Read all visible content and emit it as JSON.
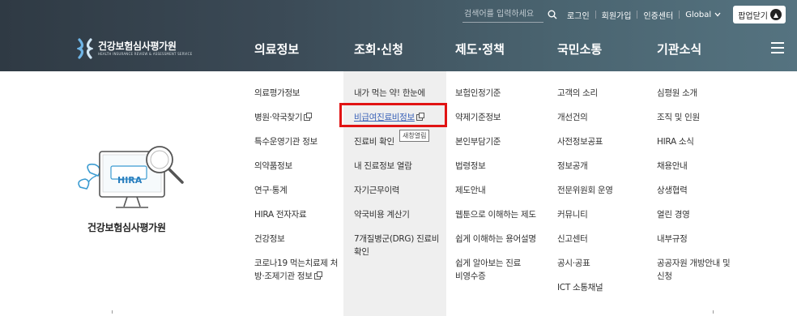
{
  "header": {
    "search_placeholder": "검색어를 입력하세요",
    "util_links": [
      "로그인",
      "회원가입",
      "인증센터"
    ],
    "global_label": "Global",
    "popup_close_label": "팝업닫기",
    "logo_ko": "건강보험심사평가원",
    "logo_en": "HEALTH INSURANCE REVIEW & ASSESSMENT SERVICE"
  },
  "gnb": [
    "의료정보",
    "조회·신청",
    "제도·정책",
    "국민소통",
    "기관소식"
  ],
  "brand": {
    "badge": "HIRA",
    "name": "건강보험심사평가원"
  },
  "menu": {
    "col1": [
      "의료평가정보",
      "병원·약국찾기",
      "특수운영기관 정보",
      "의약품정보",
      "연구·통계",
      "HIRA 전자자료",
      "건강정보",
      "코로나19 먹는치료제 처방·조제기관 정보"
    ],
    "col2": [
      "내가 먹는 약! 한눈에",
      "비급여진료비정보",
      "진료비 확인",
      "내 진료정보 열람",
      "자기근무이력",
      "약국비용 계산기",
      "7개질병군(DRG) 진료비 확인"
    ],
    "col3": [
      "보험인정기준",
      "약제기준정보",
      "본인부담기준",
      "법령정보",
      "제도안내",
      "웹툰으로 이해하는 제도",
      "쉽게 이해하는 용어설명",
      "쉽게 알아보는 진료비영수증"
    ],
    "col4": [
      "고객의 소리",
      "개선건의",
      "사전정보공표",
      "정보공개",
      "전문위원회 운영",
      "커뮤니티",
      "신고센터",
      "공시·공표",
      "ICT 소통채널"
    ],
    "col5": [
      "심평원 소개",
      "조직 및 인원",
      "HIRA 소식",
      "채용안내",
      "상생협력",
      "열린 경영",
      "내부규정",
      "공공자원 개방안내 및 신청"
    ]
  },
  "tooltip": "새창열림",
  "colors": {
    "accent": "#e11313",
    "link": "#3b63b8",
    "header": "#3b4a56"
  }
}
